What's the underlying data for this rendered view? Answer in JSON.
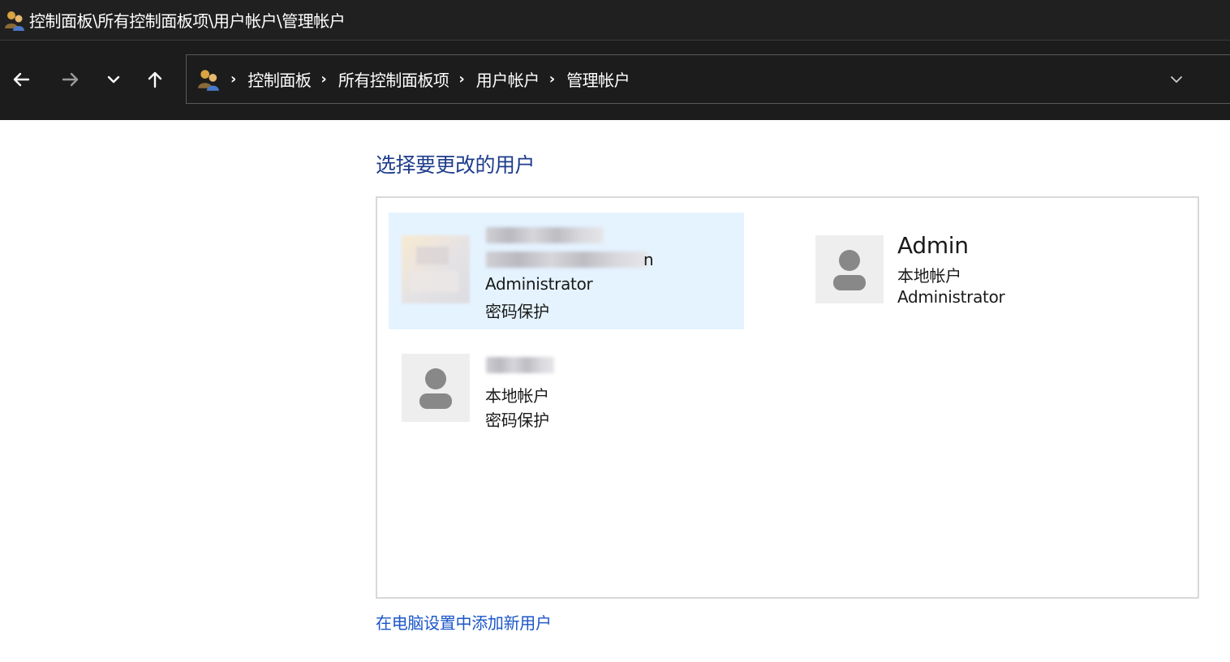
{
  "window": {
    "title": "控制面板\\所有控制面板项\\用户帐户\\管理帐户"
  },
  "nav": {
    "back_icon": "arrow-left-icon",
    "forward_icon": "arrow-right-icon",
    "recent_icon": "chevron-down-icon",
    "up_icon": "arrow-up-icon"
  },
  "address": {
    "breadcrumbs": [
      "控制面板",
      "所有控制面板项",
      "用户帐户",
      "管理帐户"
    ],
    "separator": "›"
  },
  "main": {
    "heading": "选择要更改的用户",
    "users": [
      {
        "name": "",
        "email_suffix": "n",
        "type": "Administrator",
        "status": "密码保护",
        "selected": true,
        "avatar": "blurred-photo"
      },
      {
        "name": "Admin",
        "account_kind": "本地帐户",
        "type": "Administrator",
        "selected": false,
        "avatar": "person-icon"
      },
      {
        "name": "",
        "account_kind": "本地帐户",
        "status": "密码保护",
        "selected": false,
        "avatar": "person-icon"
      }
    ],
    "add_user_link": "在电脑设置中添加新用户"
  },
  "colors": {
    "titlebar_bg": "#202020",
    "navbar_bg": "#1c1c1c",
    "heading": "#1e3c8c",
    "link": "#1a56c8",
    "selected_tile": "#e5f3ff",
    "avatar_bg": "#eeeeee",
    "avatar_figure": "#888888"
  }
}
